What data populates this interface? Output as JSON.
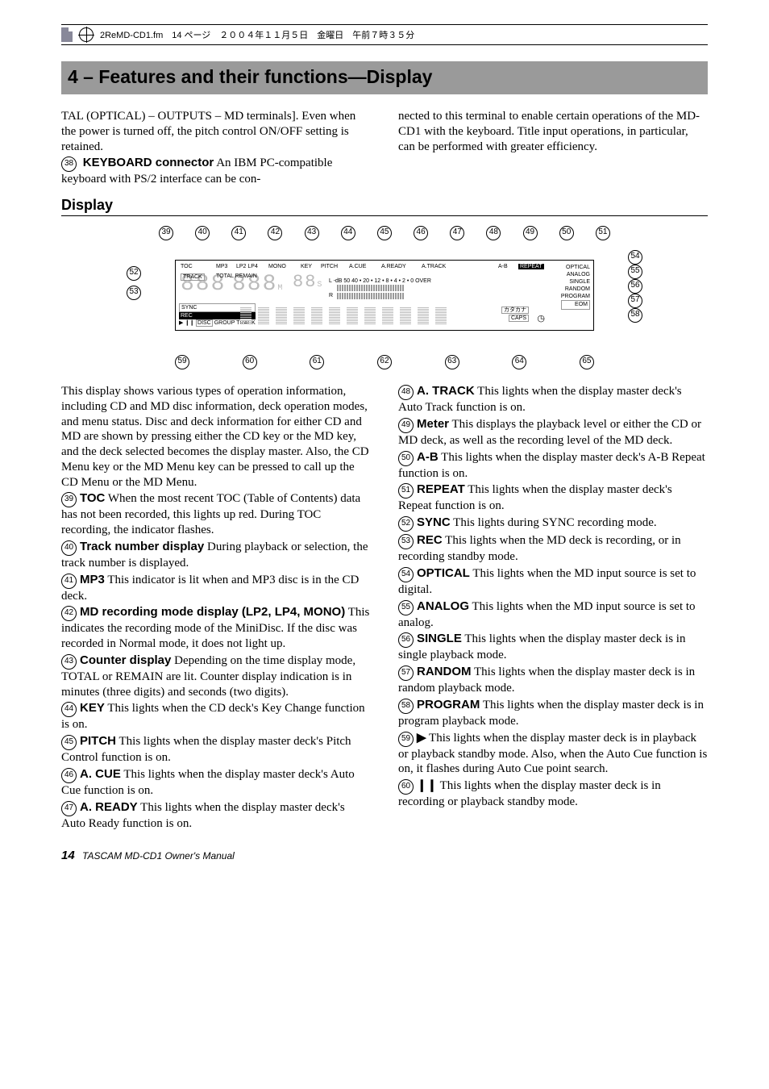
{
  "file_info": "2ReMD-CD1.fm　14 ページ　２００４年１１月５日　金曜日　午前７時３５分",
  "section_title": "4 – Features and their functions—Display",
  "intro_col1_a": "TAL (OPTICAL) – OUTPUTS – MD terminals]. Even when the power is turned off, the pitch control ON/OFF setting is retained.",
  "intro_item": {
    "num": "38",
    "label": "KEYBOARD connector",
    "text": "An IBM PC-compatible keyboard with PS/2 interface can be con-"
  },
  "intro_col2": "nected to this terminal to enable certain operations of the MD-CD1 with the keyboard. Title input operations, in particular, can be performed with greater efficiency.",
  "display_heading": "Display",
  "diagram": {
    "top_labels": [
      "TOC",
      "MP3",
      "LP2 LP4",
      "MONO",
      "KEY",
      "PITCH",
      "A.CUE",
      "A.READY",
      "A.TRACK",
      "A-B",
      "REPEAT"
    ],
    "right_labels": [
      "OPTICAL",
      "ANALOG",
      "SINGLE",
      "RANDOM",
      "PROGRAM",
      "EOM"
    ],
    "left_labels_top": [
      "TRACK",
      "TOTAL REMAIN"
    ],
    "left_labels_bottom": [
      "SYNC",
      "REC",
      "DISC",
      "GROUP",
      "TRACK"
    ],
    "meter_scale": [
      "-dB",
      "50",
      "40",
      "•",
      "20",
      "•",
      "12",
      "•",
      "8",
      "•",
      "4",
      "•",
      "2",
      "•",
      "0",
      "OVER"
    ],
    "meter_channels": "L / R",
    "caps_label": "CAPS",
    "kana_label": "カタカナ",
    "callouts_top": [
      "39",
      "40",
      "41",
      "42",
      "43",
      "44",
      "45",
      "46",
      "47",
      "48",
      "49",
      "50",
      "51"
    ],
    "callouts_right": [
      "54",
      "55",
      "56",
      "57",
      "58"
    ],
    "callouts_left": [
      "52",
      "53"
    ],
    "callouts_bottom": [
      "59",
      "60",
      "61",
      "62",
      "63",
      "64",
      "65"
    ]
  },
  "body_intro": "This display shows various types of operation information, including CD and MD disc information, deck operation modes, and menu status. Disc and deck information for either CD and MD are shown by pressing either the CD key or the MD key, and the deck selected becomes the display master. Also, the CD Menu key or the MD Menu key can be pressed to call up the CD Menu or the MD Menu.",
  "items": [
    {
      "num": "39",
      "label": "TOC",
      "text": "When the most recent TOC (Table of Contents) data has not been recorded, this lights up red. During TOC recording, the indicator flashes."
    },
    {
      "num": "40",
      "label": "Track number display",
      "text": "During playback or selection, the track number is displayed."
    },
    {
      "num": "41",
      "label": "MP3",
      "text": "This indicator is lit when and MP3 disc is in the CD deck."
    },
    {
      "num": "42",
      "label": "MD recording mode display (LP2, LP4, MONO)",
      "text": "This indicates the recording mode of the MiniDisc. If the disc was recorded in Normal mode, it does not light up."
    },
    {
      "num": "43",
      "label": "Counter display",
      "text": "Depending on the time display mode, TOTAL or REMAIN are lit. Counter display indication is in minutes (three digits) and seconds (two digits)."
    },
    {
      "num": "44",
      "label": "KEY",
      "text": "This lights when the CD deck's Key Change function is on."
    },
    {
      "num": "45",
      "label": "PITCH",
      "text": "This lights when the display master deck's Pitch Control function is on."
    },
    {
      "num": "46",
      "label": "A. CUE",
      "text": "This lights when the display master deck's Auto Cue function is on."
    },
    {
      "num": "47",
      "label": "A. READY",
      "text": "This lights when the display master deck's Auto Ready function is on."
    },
    {
      "num": "48",
      "label": "A. TRACK",
      "text": "This lights when the display master deck's Auto Track function is on."
    },
    {
      "num": "49",
      "label": "Meter",
      "text": "This displays the playback level or either the CD or MD deck, as well as the recording level of the MD deck."
    },
    {
      "num": "50",
      "label": "A-B",
      "text": "This lights when the display master deck's A-B Repeat function is on."
    },
    {
      "num": "51",
      "label": "REPEAT",
      "text": "This lights when the display master deck's Repeat function is on."
    },
    {
      "num": "52",
      "label": "SYNC",
      "text": "This lights during SYNC recording mode."
    },
    {
      "num": "53",
      "label": "REC",
      "text": "This lights when the MD deck is recording, or in recording standby mode."
    },
    {
      "num": "54",
      "label": "OPTICAL",
      "text": "This lights when the MD input source is set to digital."
    },
    {
      "num": "55",
      "label": "ANALOG",
      "text": "This lights when the MD input source is set to analog."
    },
    {
      "num": "56",
      "label": "SINGLE",
      "text": "This lights when the display master deck is in single playback mode."
    },
    {
      "num": "57",
      "label": "RANDOM",
      "text": "This lights when the display master deck is in random playback mode."
    },
    {
      "num": "58",
      "label": "PROGRAM",
      "text": "This lights when the display master deck is in program playback mode."
    },
    {
      "num": "59",
      "label": "▶",
      "text": "This lights when the display master deck is in playback or playback standby mode. Also, when the Auto Cue function is on, it flashes during Auto Cue point search."
    },
    {
      "num": "60",
      "label": "❙❙",
      "text": "This lights when the display master deck is in recording or playback standby mode."
    }
  ],
  "footer": {
    "page": "14",
    "text": "TASCAM MD-CD1 Owner's Manual"
  }
}
